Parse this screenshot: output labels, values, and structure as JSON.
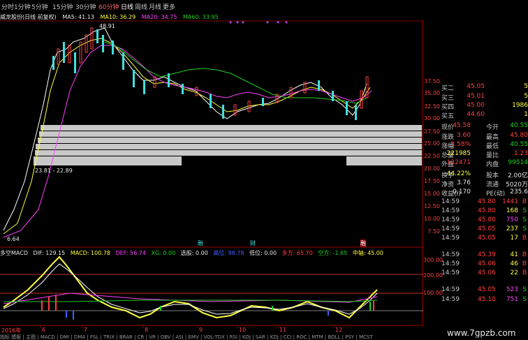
{
  "toolbar": {
    "periods": [
      "分时",
      "1分钟",
      "5分钟",
      "15分钟",
      "30分钟",
      "60分钟",
      "日线",
      "周线",
      "月线",
      "更多"
    ],
    "active": "日线"
  },
  "info": {
    "stock_label": "威龙股份(日线 前复权)",
    "ma5": "MA5: 41.13",
    "ma10": "MA10: 36.29",
    "ma20": "MA20: 34.75",
    "ma60": "MA60: 33.95",
    "high_mark": "48.91",
    "low_mark": "6.64",
    "range_label": "23.81 - 22.89",
    "event_labels": [
      "融",
      "财",
      "融"
    ]
  },
  "price_axis": [
    "37.50",
    "35.00",
    "32.50",
    "30.00",
    "27.50",
    "25.00",
    "22.50",
    "20.00",
    "17.50",
    "15.00",
    "12.50",
    "10.00",
    "7.50"
  ],
  "quotes": {
    "book": [
      {
        "label": "买二",
        "price": "45.05",
        "vol": "5"
      },
      {
        "label": "买三",
        "price": "45.01",
        "vol": "5"
      },
      {
        "label": "买四",
        "price": "45.00",
        "vol": "1986"
      },
      {
        "label": "买五",
        "price": "44.60",
        "vol": "1"
      }
    ],
    "stats": [
      {
        "l1": "现价",
        "v1": "45.58",
        "l2": "今开",
        "v2": "40.55"
      },
      {
        "l1": "涨跌",
        "v1": "3.60",
        "l2": "最高",
        "v2": "45.80"
      },
      {
        "l1": "涨幅",
        "v1": "8.58%",
        "l2": "最低",
        "v2": "40.55"
      },
      {
        "l1": "总量",
        "v1": "221985",
        "l2": "量比",
        "v2": "1.23"
      },
      {
        "l1": "外盘",
        "v1": "122471",
        "l2": "内盘",
        "v2": "99514"
      },
      {
        "l1": "换手",
        "v1": "44.22%",
        "l2": "股本",
        "v2": "2.00亿"
      },
      {
        "l1": "净资",
        "v1": "3.76",
        "l2": "流通",
        "v2": "5020万"
      },
      {
        "l1": "收益(I)",
        "v1": "0.170",
        "l2": "PE(动)",
        "v2": "235.6"
      }
    ]
  },
  "trades": [
    {
      "time": "14:59",
      "price": "45.80",
      "vol": "1441",
      "side": "B"
    },
    {
      "time": "14:59",
      "price": "45.80",
      "vol": "168",
      "side": "S"
    },
    {
      "time": "14:59",
      "price": "45.80",
      "vol": "750",
      "side": "S"
    },
    {
      "time": "14:59",
      "price": "45.05",
      "vol": "237",
      "side": "S"
    },
    {
      "time": "14:59",
      "price": "45.05",
      "vol": "17",
      "side": "B"
    },
    {
      "time": "14:59",
      "price": "45.39",
      "vol": "41",
      "side": "B"
    },
    {
      "time": "14:59",
      "price": "45.06",
      "vol": "46",
      "side": "B"
    },
    {
      "time": "14:59",
      "price": "45.06",
      "vol": "22",
      "side": "B"
    },
    {
      "time": "14:59",
      "price": "45.05",
      "vol": "523",
      "side": "S"
    },
    {
      "time": "14:59",
      "price": "45.10",
      "vol": "751",
      "side": "S"
    }
  ],
  "macd": {
    "title": "多空MACD",
    "dif": "DIF: 129.15",
    "macd": "MACD: 100.78",
    "def": "DEF: 56.74",
    "xg": "XG: 0.00",
    "xuanjiu": "选股: 0.00",
    "high": "高位: 98.78",
    "low": "低位: 0.00",
    "duofang": "多方: 65.70",
    "kongfang": "空方: -1.65",
    "zhongzhou": "中轴: 45.00",
    "axis": [
      "300.00",
      "200.00",
      "100.00"
    ]
  },
  "x_axis": [
    "2016年",
    "6",
    "7",
    "8",
    "9",
    "10",
    "11",
    "12"
  ],
  "bottom_tabs": "指标 模板 | 主图 | MACD | DMI | DMA | FSL | TRIX | BRAR | CR | VR | OBV | ASI | EMV | VOL-TDX | RSI | KDJ | SAR | KDJ | CCI | ROC | MTM | BOLL | PSY | MCST",
  "watermark": "www.7gpzb.com",
  "colors": {
    "up": "#ff4040",
    "down": "#40e0e0",
    "ma5": "#ffffff",
    "ma10": "#ffff40",
    "ma20": "#ff40ff",
    "ma60": "#20d020"
  }
}
